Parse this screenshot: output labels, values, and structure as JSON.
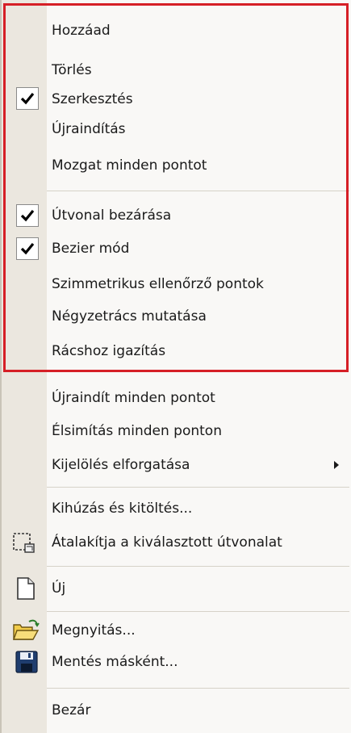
{
  "menu": {
    "items": [
      {
        "label": "Hozzáad"
      },
      {
        "label": "Törlés"
      },
      {
        "label": "Szerkesztés",
        "checked": true
      },
      {
        "label": "Újraindítás"
      },
      {
        "label": "Mozgat minden pontot"
      },
      {
        "label": "Útvonal bezárása",
        "checked": true
      },
      {
        "label": "Bezier mód",
        "checked": true
      },
      {
        "label": "Szimmetrikus ellenőrző pontok"
      },
      {
        "label": "Négyzetrács mutatása"
      },
      {
        "label": "Rácshoz igazítás"
      },
      {
        "label": "Újraindít minden pontot"
      },
      {
        "label": "Élsimítás minden ponton"
      },
      {
        "label": "Kijelölés elforgatása",
        "submenu": true
      },
      {
        "label": "Kihúzás és kitöltés..."
      },
      {
        "label": "Átalakítja a kiválasztott útvonalat",
        "icon": "transform-selection-icon"
      },
      {
        "label": "Új",
        "icon": "new-document-icon"
      },
      {
        "label": "Megnyitás...",
        "icon": "open-folder-icon"
      },
      {
        "label": "Mentés másként...",
        "icon": "floppy-disk-icon"
      },
      {
        "label": "Bezár"
      }
    ]
  },
  "colors": {
    "highlight_border": "#d61f26",
    "gutter": "#ebe7df",
    "menu_background": "#f9f8f6"
  }
}
